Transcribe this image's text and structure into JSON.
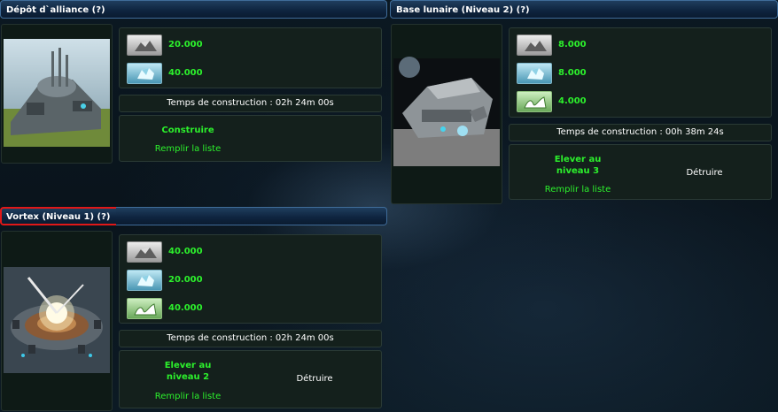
{
  "buildings": [
    {
      "title": "Dépôt d`alliance (?)",
      "image_icon": "alliance-depot-image",
      "costs": [
        {
          "type": "metal-icon",
          "value": "20.000"
        },
        {
          "type": "crystal-icon",
          "value": "40.000"
        }
      ],
      "time": "Temps de construction : 02h 24m 00s",
      "action": "Construire",
      "queue": "Remplir la liste"
    },
    {
      "title": "Base lunaire (Niveau 2) (?)",
      "image_icon": "lunar-base-image",
      "costs": [
        {
          "type": "metal-icon",
          "value": "8.000"
        },
        {
          "type": "crystal-icon",
          "value": "8.000"
        },
        {
          "type": "deuterium-icon",
          "value": "4.000"
        }
      ],
      "time": "Temps de construction : 00h 38m 24s",
      "action_line1": "Elever au",
      "action_line2": "niveau 3",
      "destroy": "Détruire",
      "queue": "Remplir la liste"
    },
    {
      "title": "Vortex (Niveau 1) (?)",
      "image_icon": "vortex-image",
      "costs": [
        {
          "type": "metal-icon",
          "value": "40.000"
        },
        {
          "type": "crystal-icon",
          "value": "20.000"
        },
        {
          "type": "deuterium-icon",
          "value": "40.000"
        }
      ],
      "time": "Temps de construction : 02h 24m 00s",
      "action_line1": "Elever au",
      "action_line2": "niveau 2",
      "destroy": "Détruire",
      "queue": "Remplir la liste"
    }
  ]
}
